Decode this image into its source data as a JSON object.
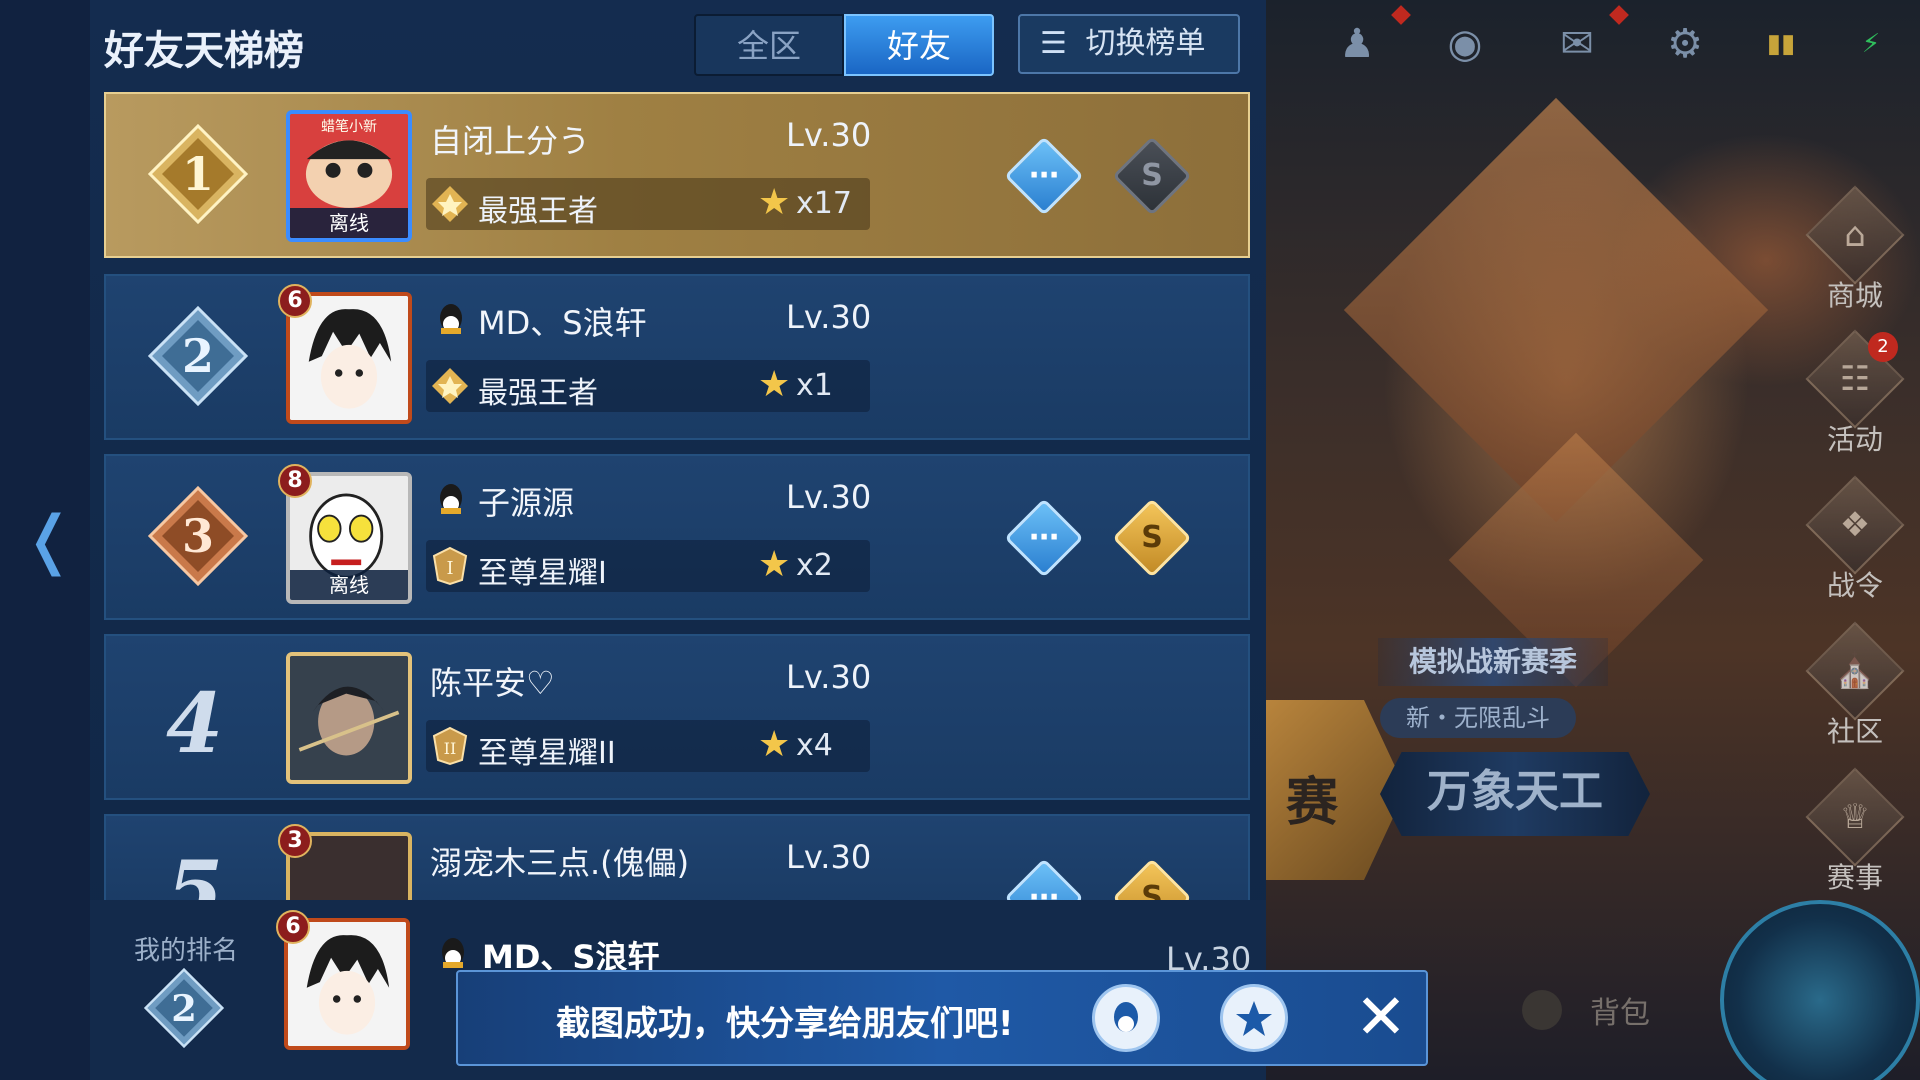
{
  "header": {
    "title": "好友天梯榜",
    "tabs": [
      {
        "label": "全区",
        "active": false
      },
      {
        "label": "好友",
        "active": true
      }
    ],
    "switch_label": "切换榜单"
  },
  "rows": [
    {
      "rank": "1",
      "name": "自闭上分う",
      "level": "Lv.30",
      "tier": "最强王者",
      "stars": "x17",
      "offline_label": "离线",
      "avatar_top_text": "蜡笔小新",
      "show_actions": true
    },
    {
      "rank": "2",
      "name": "MD、S浪轩",
      "level": "Lv.30",
      "tier": "最强王者",
      "stars": "x1",
      "badge_level": "6",
      "show_actions": false
    },
    {
      "rank": "3",
      "name": "子源源",
      "level": "Lv.30",
      "tier": "至尊星耀I",
      "stars": "x2",
      "badge_level": "8",
      "offline_label": "离线",
      "show_actions": true
    },
    {
      "rank": "4",
      "name": "陈平安♡",
      "level": "Lv.30",
      "tier": "至尊星耀II",
      "stars": "x4",
      "show_actions": false
    },
    {
      "rank": "5",
      "name": "溺宠木三点.(傀儡)",
      "level": "Lv.30",
      "badge_level": "3",
      "show_actions": true
    }
  ],
  "my_rank": {
    "label": "我的排名",
    "rank": "2",
    "name": "MD、S浪轩",
    "level": "Lv.30",
    "badge_level": "6"
  },
  "toast": {
    "text": "截图成功，快分享给朋友们吧!",
    "qq_icon": "qq-icon",
    "qzone_icon": "qzone-icon",
    "close_icon": "close-icon"
  },
  "side_menu": [
    {
      "label": "商城",
      "icon": "shop-icon"
    },
    {
      "label": "活动",
      "icon": "activity-icon",
      "badge": "2"
    },
    {
      "label": "战令",
      "icon": "battle-pass-icon"
    },
    {
      "label": "社区",
      "icon": "community-icon"
    },
    {
      "label": "赛事",
      "icon": "trophy-icon"
    }
  ],
  "promo": {
    "tag": "模拟战新赛季",
    "sub": "新・无限乱斗",
    "big": "万象天工",
    "left": "赛"
  },
  "bag_label": "背包",
  "colors": {
    "panel": "#142c4f",
    "first_row_gold": "#b89a5f",
    "accent_blue": "#3d9cf0",
    "star": "#f3c64a"
  }
}
